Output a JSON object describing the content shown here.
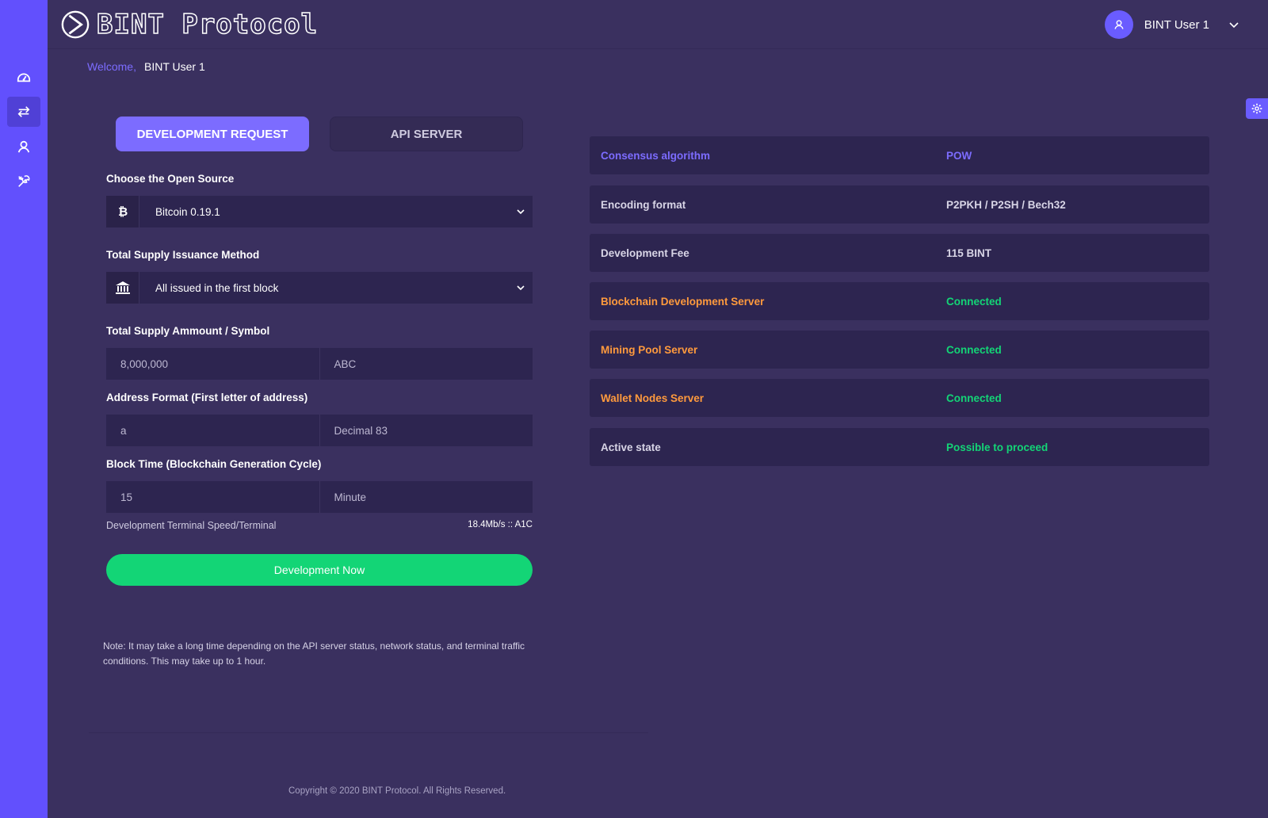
{
  "header": {
    "brand": "BINT Protocol",
    "user_name": "BINT User 1"
  },
  "welcome": {
    "label": "Welcome,",
    "name": "BINT User 1"
  },
  "sidebar": {
    "items": [
      {
        "icon": "dashboard-icon"
      },
      {
        "icon": "exchange-icon",
        "active": true
      },
      {
        "icon": "user-icon"
      },
      {
        "icon": "tools-icon"
      }
    ]
  },
  "tabs": {
    "development_request": "DEVELOPMENT REQUEST",
    "api_server": "API SERVER"
  },
  "form": {
    "open_source_label": "Choose the Open Source",
    "open_source_value": "Bitcoin 0.19.1",
    "issuance_label": "Total Supply Issuance Method",
    "issuance_value": "All issued in the first block",
    "supply_label": "Total Supply Ammount / Symbol",
    "supply_amount": "8,000,000",
    "supply_symbol": "ABC",
    "address_label": "Address Format (First letter of address)",
    "address_letter": "a",
    "address_decimal": "Decimal 83",
    "block_time_label": "Block Time (Blockchain Generation Cycle)",
    "block_time_value": "15",
    "block_time_unit": "Minute",
    "speed_label": "Development Terminal Speed/Terminal",
    "speed_value": "18.4Mb/s :: A1C",
    "submit_label": "Development Now",
    "note": "Note: It may take a long time depending on the API server status, network status, and terminal traffic conditions. This may take up to 1 hour."
  },
  "status": {
    "rows": [
      {
        "key": "Consensus algorithm",
        "value": "POW"
      },
      {
        "key": "Encoding format",
        "value": "P2PKH / P2SH / Bech32"
      },
      {
        "key": "Development Fee",
        "value": "115 BINT"
      },
      {
        "key": "Blockchain Development Server",
        "value": "Connected"
      },
      {
        "key": "Mining Pool Server",
        "value": "Connected"
      },
      {
        "key": "Wallet Nodes Server",
        "value": "Connected"
      },
      {
        "key": "Active state",
        "value": "Possible to proceed"
      }
    ]
  },
  "footer": {
    "copyright": "Copyright © 2020 BINT Protocol. All Rights Reserved."
  },
  "colors": {
    "background": "#3a305f",
    "sidebar": "#6250fd",
    "accent": "#7c6cff",
    "success": "#13d576",
    "warning": "#ff9a3d"
  }
}
